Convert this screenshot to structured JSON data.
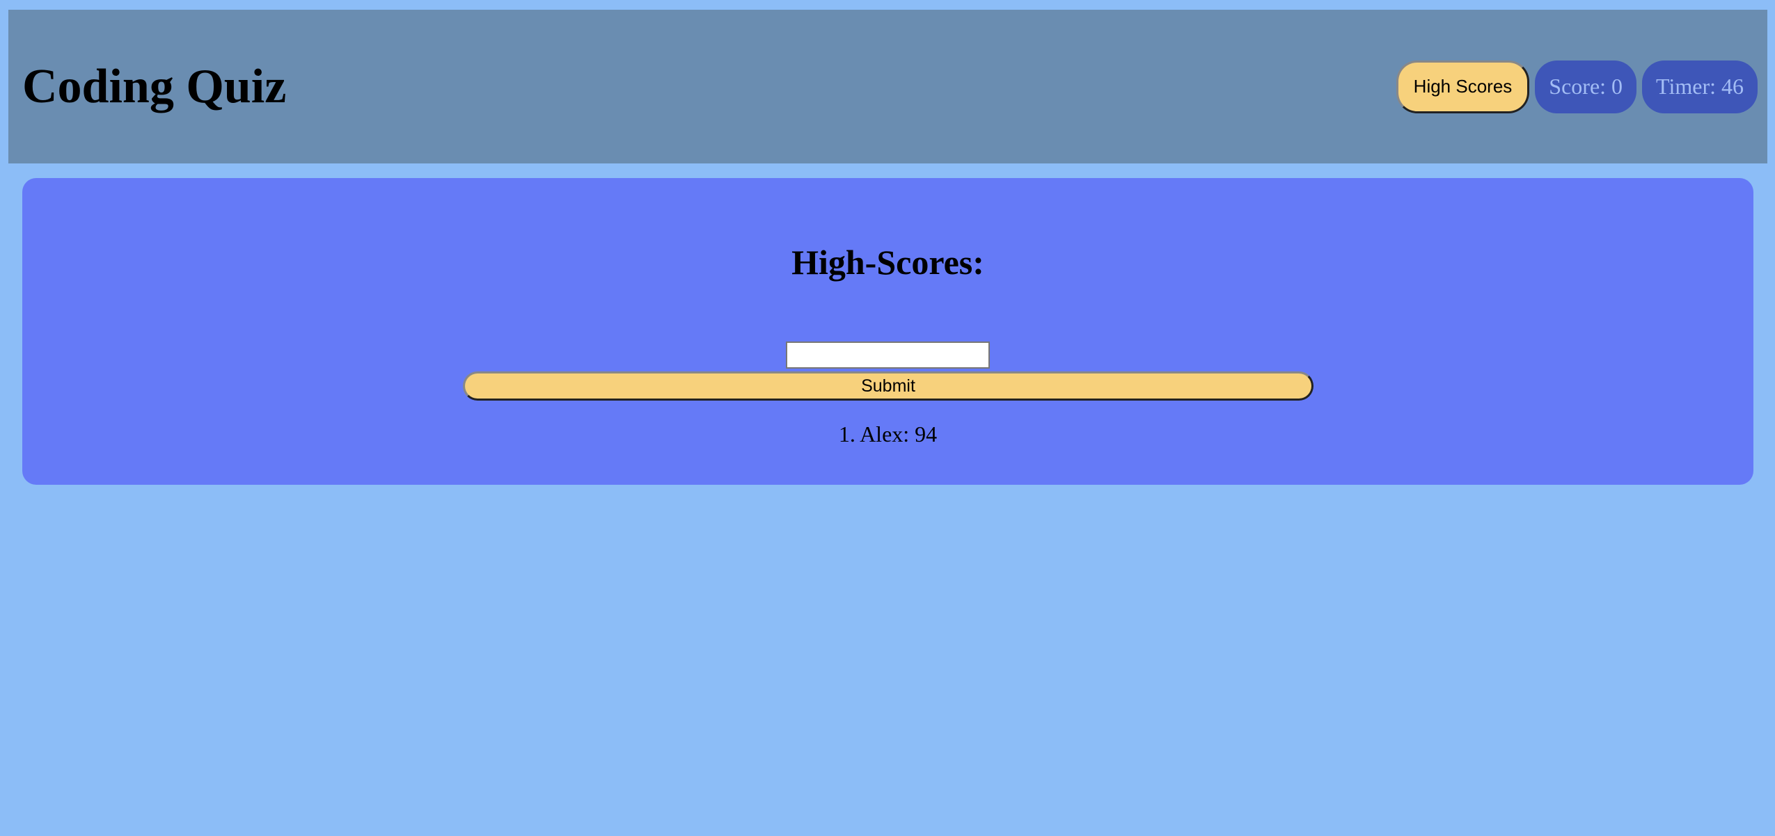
{
  "header": {
    "title": "Coding Quiz",
    "high_scores_label": "High Scores",
    "score_text": "Score: 0",
    "timer_text": "Timer: 46"
  },
  "highscores": {
    "heading": "High-Scores:",
    "initials_input": {
      "value": "",
      "placeholder": ""
    },
    "submit_label": "Submit",
    "entries": [
      {
        "text": "1. Alex: 94"
      }
    ]
  },
  "colors": {
    "page_background": "#8cbdf7",
    "header_background": "#6a8db1",
    "card_background": "#657af7",
    "button_background": "#f7d17c",
    "pill_background": "#3e56b8",
    "pill_text": "#a3bdf5"
  }
}
